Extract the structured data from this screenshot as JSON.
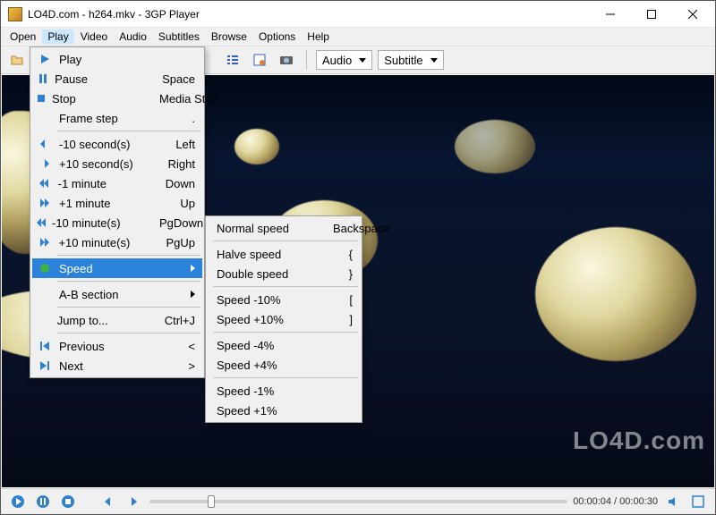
{
  "window": {
    "title": "LO4D.com - h264.mkv - 3GP Player"
  },
  "menubar": [
    "Open",
    "Play",
    "Video",
    "Audio",
    "Subtitles",
    "Browse",
    "Options",
    "Help"
  ],
  "toolbar": {
    "audio": "Audio",
    "subtitle": "Subtitle"
  },
  "playMenu": {
    "play": "Play",
    "pause": {
      "l": "Pause",
      "s": "Space"
    },
    "stop": {
      "l": "Stop",
      "s": "Media Stop"
    },
    "frameStep": {
      "l": "Frame step",
      "s": "."
    },
    "m10s": {
      "l": "-10 second(s)",
      "s": "Left"
    },
    "p10s": {
      "l": "+10 second(s)",
      "s": "Right"
    },
    "m1m": {
      "l": "-1 minute",
      "s": "Down"
    },
    "p1m": {
      "l": "+1 minute",
      "s": "Up"
    },
    "m10m": {
      "l": "-10 minute(s)",
      "s": "PgDown"
    },
    "p10m": {
      "l": "+10 minute(s)",
      "s": "PgUp"
    },
    "speed": "Speed",
    "ab": "A-B section",
    "jump": {
      "l": "Jump to...",
      "s": "Ctrl+J"
    },
    "prev": {
      "l": "Previous",
      "s": "<"
    },
    "next": {
      "l": "Next",
      "s": ">"
    }
  },
  "speedMenu": {
    "normal": {
      "l": "Normal speed",
      "s": "Backspace"
    },
    "halve": {
      "l": "Halve speed",
      "s": "{"
    },
    "double": {
      "l": "Double speed",
      "s": "}"
    },
    "m10": {
      "l": "Speed -10%",
      "s": "["
    },
    "p10": {
      "l": "Speed +10%",
      "s": "]"
    },
    "m4": {
      "l": "Speed -4%",
      "s": ""
    },
    "p4": {
      "l": "Speed +4%",
      "s": ""
    },
    "m1": {
      "l": "Speed -1%",
      "s": ""
    },
    "p1": {
      "l": "Speed +1%",
      "s": ""
    }
  },
  "status": {
    "time": "00:00:04 / 00:00:30"
  },
  "watermark": "LO4D.com"
}
